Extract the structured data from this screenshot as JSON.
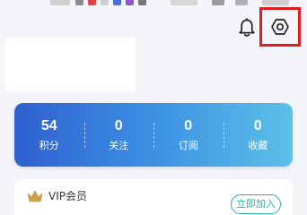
{
  "colors": {
    "highlight_border": "#e01d1d",
    "card_gradient_start": "#2f5fd0",
    "card_gradient_end": "#5cc0e8",
    "vip_gold": "#c9a24a",
    "join_green": "#2bb3a0",
    "icon_dark": "#222222"
  },
  "header": {
    "bell_icon": "bell-icon",
    "settings_icon": "settings-icon"
  },
  "stats": [
    {
      "value": "54",
      "label": "积分"
    },
    {
      "value": "0",
      "label": "关注"
    },
    {
      "value": "0",
      "label": "订阅"
    },
    {
      "value": "0",
      "label": "收藏"
    }
  ],
  "vip": {
    "icon": "crown-icon",
    "label": "VIP会员",
    "join_label": "立即加入"
  }
}
